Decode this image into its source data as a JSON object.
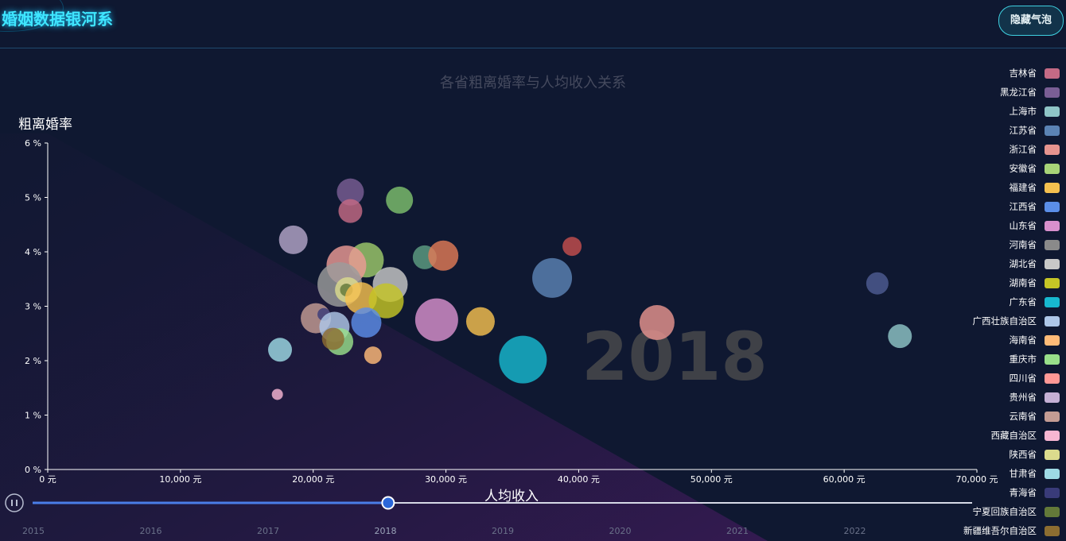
{
  "header": {
    "title": "婚姻数据银河系",
    "toggle_label": "隐藏气泡"
  },
  "chart_data": {
    "type": "scatter",
    "title": "各省粗离婚率与人均收入关系",
    "xlabel": "人均收入",
    "ylabel": "粗离婚率",
    "xlim": [
      0,
      70000
    ],
    "ylim": [
      0,
      6
    ],
    "x_ticks": [
      "0 元",
      "10,000 元",
      "20,000 元",
      "30,000 元",
      "40,000 元",
      "50,000 元",
      "60,000 元",
      "70,000 元"
    ],
    "y_ticks": [
      "0 %",
      "1 %",
      "2 %",
      "3 %",
      "4 %",
      "5 %",
      "6 %"
    ],
    "year_watermark": "2018",
    "legend_position": "right",
    "legend": [
      {
        "name": "吉林省",
        "color": "#c46a85"
      },
      {
        "name": "黑龙江省",
        "color": "#7a5e95"
      },
      {
        "name": "上海市",
        "color": "#8fc5c7"
      },
      {
        "name": "江苏省",
        "color": "#5b83b4"
      },
      {
        "name": "浙江省",
        "color": "#e6948f"
      },
      {
        "name": "安徽省",
        "color": "#a7d478"
      },
      {
        "name": "福建省",
        "color": "#f5c04f"
      },
      {
        "name": "江西省",
        "color": "#5b8ee8"
      },
      {
        "name": "山东省",
        "color": "#d890cd"
      },
      {
        "name": "河南省",
        "color": "#8a8a8a"
      },
      {
        "name": "湖北省",
        "color": "#c8c8c8"
      },
      {
        "name": "湖南省",
        "color": "#c5c526"
      },
      {
        "name": "广东省",
        "color": "#17b8cf"
      },
      {
        "name": "广西壮族自治区",
        "color": "#aec7e8"
      },
      {
        "name": "海南省",
        "color": "#ffbb78"
      },
      {
        "name": "重庆市",
        "color": "#98df8a"
      },
      {
        "name": "四川省",
        "color": "#ff9896"
      },
      {
        "name": "贵州省",
        "color": "#c5b0d5"
      },
      {
        "name": "云南省",
        "color": "#c49c94"
      },
      {
        "name": "西藏自治区",
        "color": "#f7b6d2"
      },
      {
        "name": "陕西省",
        "color": "#dbdb8d"
      },
      {
        "name": "甘肃省",
        "color": "#9edae5"
      },
      {
        "name": "青海省",
        "color": "#393b79"
      },
      {
        "name": "宁夏回族自治区",
        "color": "#637939"
      },
      {
        "name": "新疆维吾尔自治区",
        "color": "#8c6d31"
      }
    ],
    "points": [
      {
        "x": 22800,
        "y": 5.1,
        "r": 17,
        "color": "#7a5e95"
      },
      {
        "x": 26500,
        "y": 4.95,
        "r": 17,
        "color": "#7ebf6e"
      },
      {
        "x": 22800,
        "y": 4.75,
        "r": 15,
        "color": "#c46a85"
      },
      {
        "x": 18500,
        "y": 4.22,
        "r": 18,
        "color": "#b3a5c8"
      },
      {
        "x": 39500,
        "y": 4.1,
        "r": 12,
        "color": "#c44e4e"
      },
      {
        "x": 28400,
        "y": 3.9,
        "r": 15,
        "color": "#5e9e82"
      },
      {
        "x": 29800,
        "y": 3.93,
        "r": 19,
        "color": "#e07a57"
      },
      {
        "x": 24000,
        "y": 3.85,
        "r": 22,
        "color": "#9dc96b"
      },
      {
        "x": 22500,
        "y": 3.75,
        "r": 25,
        "color": "#eb9a95"
      },
      {
        "x": 38000,
        "y": 3.52,
        "r": 25,
        "color": "#5b83b4"
      },
      {
        "x": 62500,
        "y": 3.42,
        "r": 14,
        "color": "#4e5c93"
      },
      {
        "x": 22000,
        "y": 3.4,
        "r": 28,
        "color": "#9c9c9c"
      },
      {
        "x": 25800,
        "y": 3.4,
        "r": 22,
        "color": "#c8c8c8"
      },
      {
        "x": 22600,
        "y": 3.3,
        "r": 16,
        "color": "#dbdb8d"
      },
      {
        "x": 22500,
        "y": 3.3,
        "r": 8,
        "color": "#637939"
      },
      {
        "x": 23600,
        "y": 3.15,
        "r": 20,
        "color": "#f5c04f"
      },
      {
        "x": 25500,
        "y": 3.1,
        "r": 22,
        "color": "#c5c526"
      },
      {
        "x": 20200,
        "y": 2.78,
        "r": 19,
        "color": "#c49c94"
      },
      {
        "x": 20800,
        "y": 2.85,
        "r": 8,
        "color": "#393b79"
      },
      {
        "x": 29300,
        "y": 2.75,
        "r": 27,
        "color": "#d890cd"
      },
      {
        "x": 32600,
        "y": 2.72,
        "r": 18,
        "color": "#f5c04f"
      },
      {
        "x": 24000,
        "y": 2.7,
        "r": 19,
        "color": "#5b8ee8"
      },
      {
        "x": 45900,
        "y": 2.7,
        "r": 22,
        "color": "#e6948f"
      },
      {
        "x": 21600,
        "y": 2.62,
        "r": 19,
        "color": "#aec7e8"
      },
      {
        "x": 64200,
        "y": 2.45,
        "r": 15,
        "color": "#8fc5c7"
      },
      {
        "x": 22000,
        "y": 2.35,
        "r": 17,
        "color": "#98df8a"
      },
      {
        "x": 21500,
        "y": 2.4,
        "r": 14,
        "color": "#8c6d31"
      },
      {
        "x": 17500,
        "y": 2.2,
        "r": 15,
        "color": "#9edae5"
      },
      {
        "x": 24500,
        "y": 2.1,
        "r": 11,
        "color": "#ffbb78"
      },
      {
        "x": 35800,
        "y": 2.02,
        "r": 30,
        "color": "#17b8cf"
      },
      {
        "x": 17300,
        "y": 1.38,
        "r": 7,
        "color": "#f7b6d2"
      }
    ]
  },
  "timeline": {
    "years": [
      "2015",
      "2016",
      "2017",
      "2018",
      "2019",
      "2020",
      "2021",
      "2022"
    ],
    "current": "2018",
    "progress": 0.375,
    "play_icon": "pause-icon"
  }
}
